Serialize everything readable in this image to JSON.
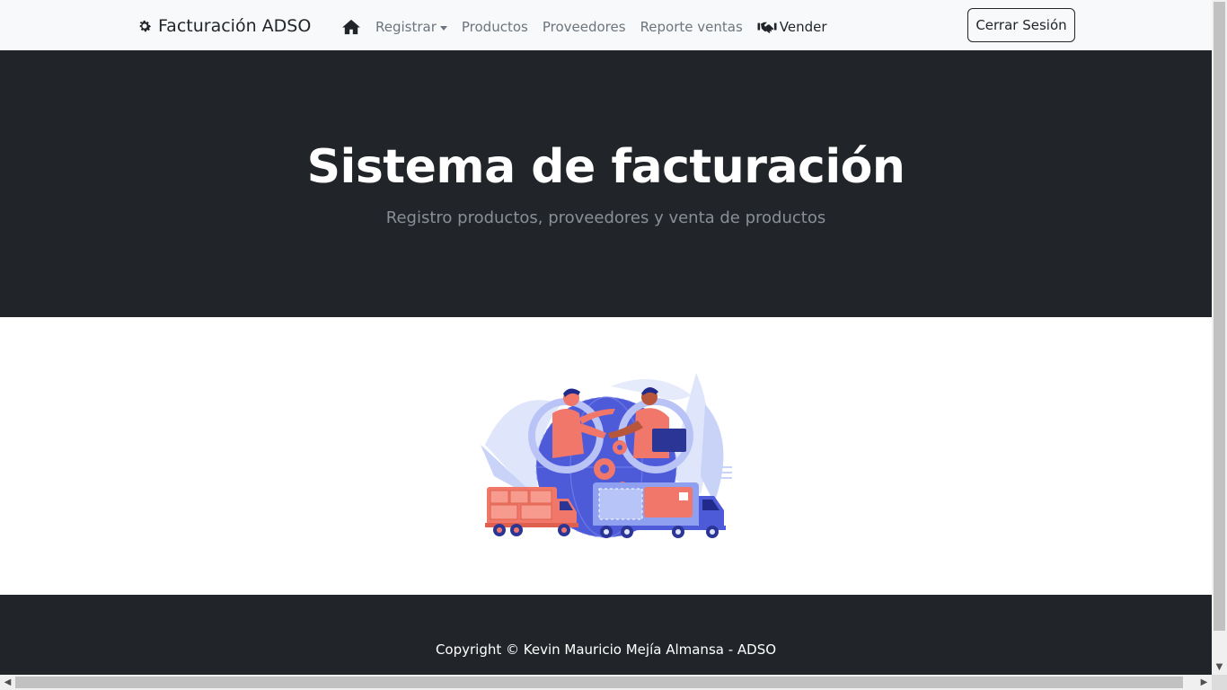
{
  "navbar": {
    "brand": "Facturación ADSO",
    "brand_icon": "gear-icon",
    "items": [
      {
        "label": "",
        "icon": "home-icon"
      },
      {
        "label": "Registrar",
        "dropdown": true
      },
      {
        "label": "Productos"
      },
      {
        "label": "Proveedores"
      },
      {
        "label": "Reporte ventas"
      },
      {
        "label": "Vender",
        "icon": "handshake-icon"
      }
    ],
    "logout_label": "Cerrar Sesión"
  },
  "hero": {
    "title": "Sistema de facturación",
    "subtitle": "Registro productos, proveedores y venta de productos"
  },
  "footer": {
    "copyright": "Copyright © Kevin Mauricio Mejía Almansa - ADSO"
  },
  "colors": {
    "dark": "#212529",
    "navbar_bg": "#f8f9fa",
    "muted": "#6c757d",
    "illustration_blue": "#4e5bd8",
    "illustration_coral": "#f0776a"
  }
}
